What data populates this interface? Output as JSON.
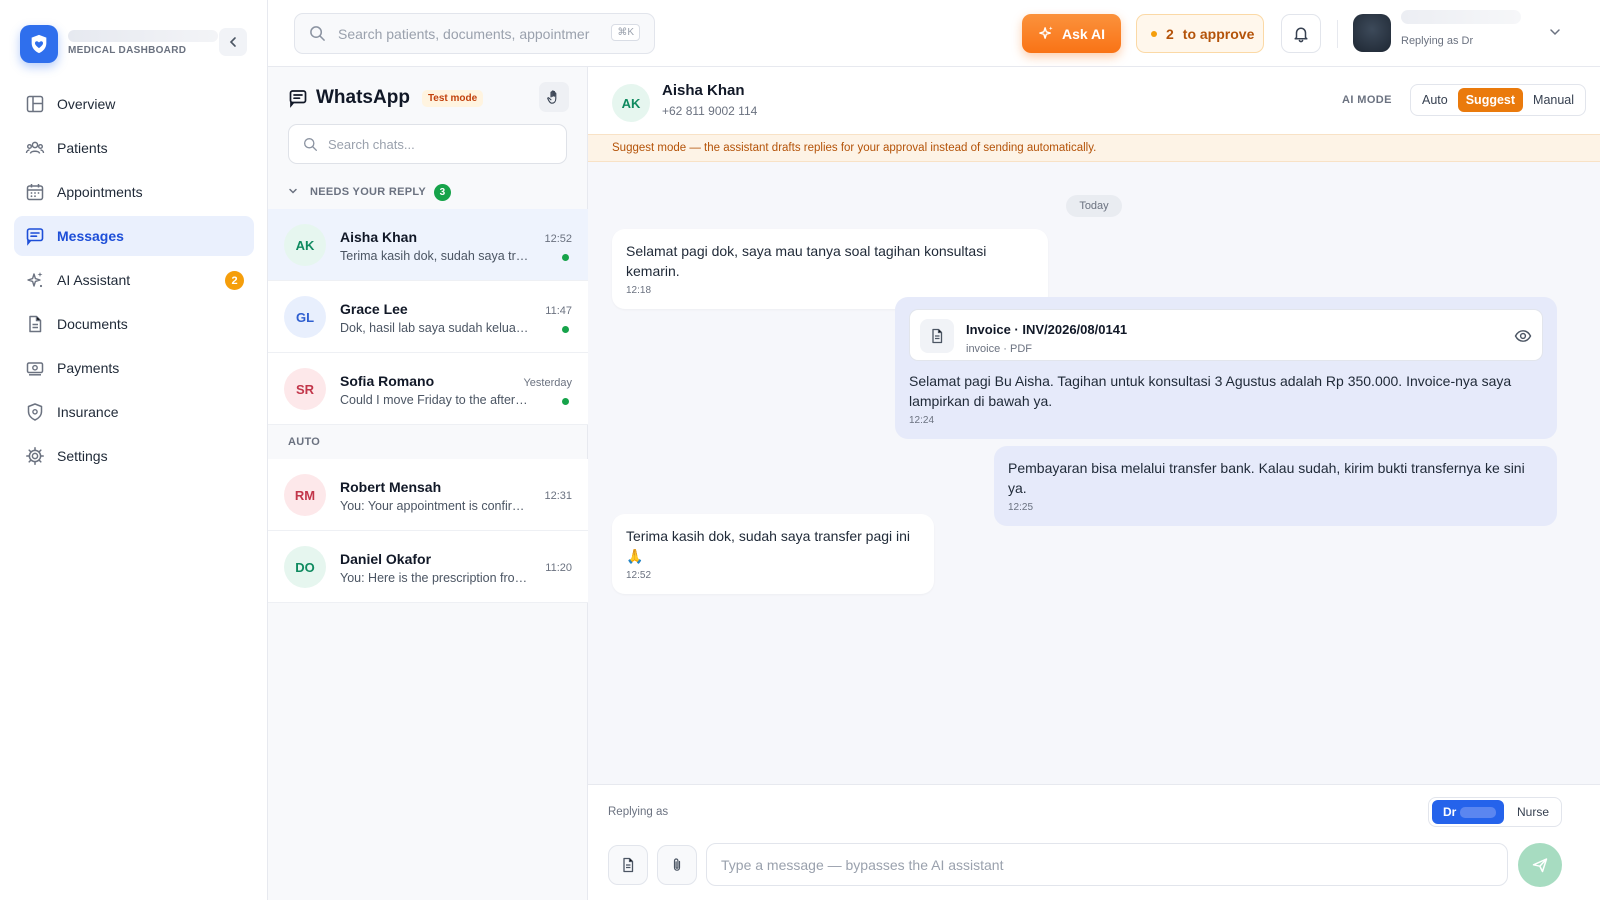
{
  "brand": {
    "subtitle": "MEDICAL DASHBOARD"
  },
  "sidebar": {
    "items": [
      {
        "label": "Overview",
        "icon": "overview-icon"
      },
      {
        "label": "Patients",
        "icon": "patients-icon"
      },
      {
        "label": "Appointments",
        "icon": "calendar-icon"
      },
      {
        "label": "Messages",
        "icon": "messages-icon",
        "active": true
      },
      {
        "label": "AI Assistant",
        "icon": "sparkle-icon",
        "badge": "2"
      },
      {
        "label": "Documents",
        "icon": "document-icon"
      },
      {
        "label": "Payments",
        "icon": "payments-icon"
      },
      {
        "label": "Insurance",
        "icon": "shield-icon"
      },
      {
        "label": "Settings",
        "icon": "gear-icon"
      }
    ]
  },
  "topbar": {
    "search_placeholder": "Search patients, documents, appointmer",
    "shortcut": "⌘K",
    "ask_ai": "Ask AI",
    "approve_count": "2",
    "approve_label": "to approve",
    "user_role": "Replying as Dr"
  },
  "chatlist": {
    "title": "WhatsApp",
    "test_mode": "Test mode",
    "search_placeholder": "Search chats...",
    "needs_reply": {
      "label": "NEEDS YOUR REPLY",
      "count": "3"
    },
    "auto_label": "AUTO",
    "chats": [
      {
        "initials": "AK",
        "name": "Aisha Khan",
        "preview": "Terima kasih dok, sudah saya transfer pagi ini",
        "time": "12:52",
        "unread": true,
        "selected": true
      },
      {
        "initials": "GL",
        "name": "Grace Lee",
        "preview": "Dok, hasil lab saya sudah keluar. Bisa dicek?",
        "time": "11:47",
        "unread": true
      },
      {
        "initials": "SR",
        "name": "Sofia Romano",
        "preview": "Could I move Friday to the afternoon?",
        "time": "Yesterday",
        "unread": true
      },
      {
        "initials": "RM",
        "name": "Robert Mensah",
        "preview": "You: Your appointment is confirmed for",
        "time": "12:31"
      },
      {
        "initials": "DO",
        "name": "Daniel Okafor",
        "preview": "You: Here is the prescription from today",
        "time": "11:20"
      }
    ]
  },
  "conversation": {
    "initials": "AK",
    "name": "Aisha Khan",
    "phone": "+62 811 9002 114",
    "ai_mode_label": "AI MODE",
    "modes": [
      "Auto",
      "Suggest",
      "Manual"
    ],
    "active_mode": "Suggest",
    "banner": "Suggest mode — the assistant drafts replies for your approval instead of sending automatically.",
    "day": "Today",
    "messages": [
      {
        "dir": "in",
        "text": "Selamat pagi dok, saya mau tanya soal tagihan konsultasi kemarin.",
        "time": "12:18"
      },
      {
        "dir": "out",
        "attachment": {
          "title": "Invoice · INV/2026/08/0141",
          "meta": "invoice · PDF"
        },
        "text": "Selamat pagi Bu Aisha. Tagihan untuk konsultasi 3 Agustus adalah Rp 350.000. Invoice-nya saya lampirkan di bawah ya.",
        "time": "12:24"
      },
      {
        "dir": "out",
        "text": "Pembayaran bisa melalui transfer bank. Kalau sudah, kirim bukti transfernya ke sini ya.",
        "time": "12:25"
      },
      {
        "dir": "in",
        "text": "Terima kasih dok, sudah saya transfer pagi ini 🙏",
        "time": "12:52"
      }
    ]
  },
  "composer": {
    "replying_as": "Replying as",
    "roles": [
      "Dr",
      "Nurse"
    ],
    "placeholder": "Type a message — bypasses the AI assistant"
  },
  "colors": {
    "accent": "#2563eb",
    "ai_orange": "#f97316",
    "unread_green": "#16a34a"
  }
}
